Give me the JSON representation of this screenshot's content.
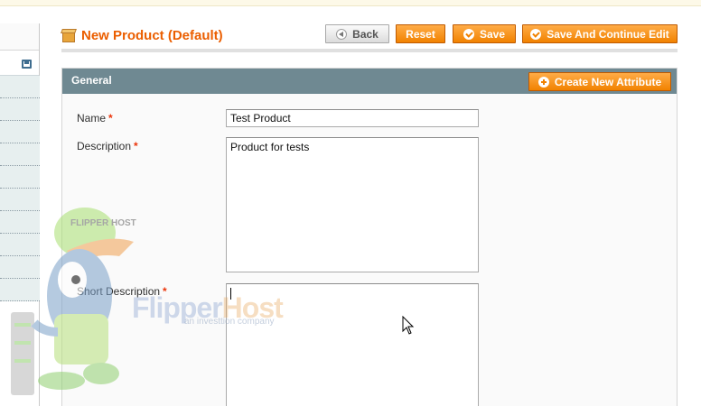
{
  "header": {
    "title": "New Product (Default)",
    "buttons": {
      "back": "Back",
      "reset": "Reset",
      "save": "Save",
      "save_continue": "Save And Continue Edit"
    }
  },
  "sidebar": {
    "tab_count": 10
  },
  "section": {
    "title": "General",
    "create_attribute_label": "Create New Attribute"
  },
  "form": {
    "name": {
      "label": "Name",
      "required_mark": "*",
      "value": "Test Product"
    },
    "description": {
      "label": "Description",
      "required_mark": "*",
      "value": "Product for tests"
    },
    "short_description": {
      "label": "Short Description",
      "required_mark": "*",
      "value": ""
    }
  },
  "watermark": {
    "brand_part1": "Flipper",
    "brand_part2": "Host",
    "tagline": "an investtion company",
    "cap_text": "FLIPPER HOST"
  },
  "colors": {
    "accent": "#eb5e00",
    "button_orange": "#f18200",
    "section_header": "#6f8992",
    "required": "#eb340a"
  }
}
